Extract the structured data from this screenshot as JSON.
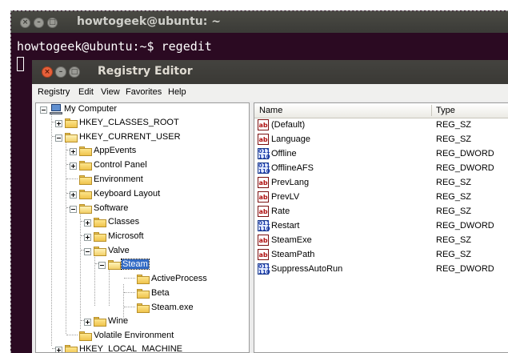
{
  "terminal": {
    "title": "howtogeek@ubuntu: ~",
    "prompt": "howtogeek@ubuntu:~$ regedit"
  },
  "regedit": {
    "title": "Registry Editor",
    "menu": [
      {
        "label": "Registry"
      },
      {
        "label": "Edit"
      },
      {
        "label": "View"
      },
      {
        "label": "Favorites"
      },
      {
        "label": "Help"
      }
    ],
    "tree": [
      {
        "label": "My Computer"
      },
      {
        "label": "HKEY_CLASSES_ROOT"
      },
      {
        "label": "HKEY_CURRENT_USER"
      },
      {
        "label": "AppEvents"
      },
      {
        "label": "Control Panel"
      },
      {
        "label": "Environment"
      },
      {
        "label": "Keyboard Layout"
      },
      {
        "label": "Software"
      },
      {
        "label": "Classes"
      },
      {
        "label": "Microsoft"
      },
      {
        "label": "Valve"
      },
      {
        "label": "Steam",
        "selected": true
      },
      {
        "label": "ActiveProcess"
      },
      {
        "label": "Beta"
      },
      {
        "label": "Steam.exe"
      },
      {
        "label": "Wine"
      },
      {
        "label": "Volatile Environment"
      },
      {
        "label": "HKEY_LOCAL_MACHINE"
      }
    ],
    "columns": {
      "name": "Name",
      "type": "Type"
    },
    "values": [
      {
        "name": "(Default)",
        "type": "REG_SZ",
        "icon": "string-value-icon"
      },
      {
        "name": "Language",
        "type": "REG_SZ",
        "icon": "string-value-icon"
      },
      {
        "name": "Offline",
        "type": "REG_DWORD",
        "icon": "binary-value-icon"
      },
      {
        "name": "OfflineAFS",
        "type": "REG_DWORD",
        "icon": "binary-value-icon"
      },
      {
        "name": "PrevLang",
        "type": "REG_SZ",
        "icon": "string-value-icon"
      },
      {
        "name": "PrevLV",
        "type": "REG_SZ",
        "icon": "string-value-icon"
      },
      {
        "name": "Rate",
        "type": "REG_SZ",
        "icon": "string-value-icon"
      },
      {
        "name": "Restart",
        "type": "REG_DWORD",
        "icon": "binary-value-icon"
      },
      {
        "name": "SteamExe",
        "type": "REG_SZ",
        "icon": "string-value-icon"
      },
      {
        "name": "SteamPath",
        "type": "REG_SZ",
        "icon": "string-value-icon"
      },
      {
        "name": "SuppressAutoRun",
        "type": "REG_DWORD",
        "icon": "binary-value-icon"
      }
    ]
  }
}
